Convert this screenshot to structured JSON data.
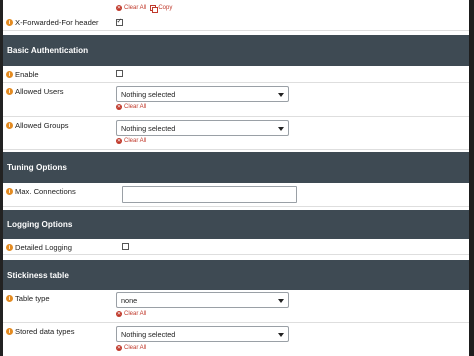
{
  "top": {
    "clear_all": "Clear All",
    "copy": "Copy"
  },
  "xff": {
    "label": "X-Forwarded-For header",
    "checked": true
  },
  "sections": {
    "basic_auth": "Basic Authentication",
    "tuning": "Tuning Options",
    "logging": "Logging Options",
    "stickiness": "Stickiness table"
  },
  "enable": {
    "label": "Enable"
  },
  "allowed_users": {
    "label": "Allowed Users",
    "value": "Nothing selected",
    "clear": "Clear All"
  },
  "allowed_groups": {
    "label": "Allowed Groups",
    "value": "Nothing selected",
    "clear": "Clear All"
  },
  "max_connections": {
    "label": "Max. Connections",
    "value": ""
  },
  "detailed_logging": {
    "label": "Detailed Logging"
  },
  "table_type": {
    "label": "Table type",
    "value": "none",
    "clear": "Clear All"
  },
  "stored_data_types": {
    "label": "Stored data types",
    "value": "Nothing selected",
    "clear": "Clear All"
  },
  "colors": {
    "section_bg": "#3e4a53",
    "info": "#e38b22",
    "clear": "#c0392b"
  }
}
